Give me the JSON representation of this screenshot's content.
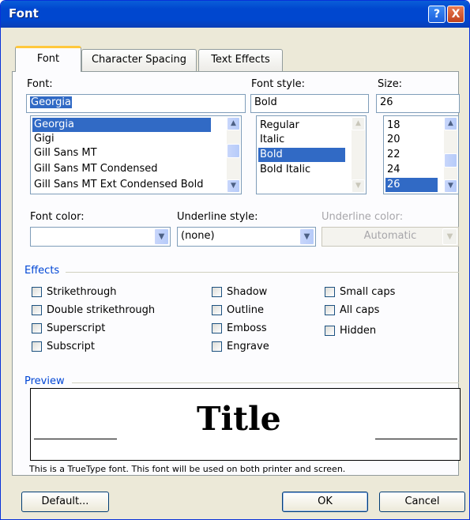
{
  "window": {
    "title": "Font",
    "help_label": "?",
    "close_label": "X"
  },
  "tabs": [
    {
      "label": "Font",
      "active": true
    },
    {
      "label": "Character Spacing",
      "active": false
    },
    {
      "label": "Text Effects",
      "active": false
    }
  ],
  "font": {
    "label": "Font:",
    "value": "Georgia",
    "items": [
      "Georgia",
      "Gigi",
      "Gill Sans MT",
      "Gill Sans MT Condensed",
      "Gill Sans MT Ext Condensed Bold"
    ],
    "selected": "Georgia"
  },
  "font_style": {
    "label": "Font style:",
    "value": "Bold",
    "items": [
      "Regular",
      "Italic",
      "Bold",
      "Bold Italic"
    ],
    "selected": "Bold"
  },
  "size": {
    "label": "Size:",
    "value": "26",
    "items": [
      "18",
      "20",
      "22",
      "24",
      "26"
    ],
    "selected": "26"
  },
  "font_color": {
    "label": "Font color:",
    "value": ""
  },
  "underline_style": {
    "label": "Underline style:",
    "value": "(none)"
  },
  "underline_color": {
    "label": "Underline color:",
    "value": "Automatic"
  },
  "effects": {
    "label": "Effects",
    "col1": [
      {
        "label": "Strikethrough",
        "checked": false
      },
      {
        "label": "Double strikethrough",
        "checked": false
      },
      {
        "label": "Superscript",
        "checked": false
      },
      {
        "label": "Subscript",
        "checked": false
      }
    ],
    "col2": [
      {
        "label": "Shadow",
        "checked": false
      },
      {
        "label": "Outline",
        "checked": false
      },
      {
        "label": "Emboss",
        "checked": false
      },
      {
        "label": "Engrave",
        "checked": false
      }
    ],
    "col3": [
      {
        "label": "Small caps",
        "checked": false
      },
      {
        "label": "All caps",
        "checked": false
      },
      {
        "label": "Hidden",
        "checked": false
      }
    ]
  },
  "preview": {
    "label": "Preview",
    "sample_text": "Title",
    "note": "This is a TrueType font. This font will be used on both printer and screen."
  },
  "buttons": {
    "default": "Default...",
    "ok": "OK",
    "cancel": "Cancel"
  },
  "colors": {
    "title_bar": "#0047cf",
    "selection": "#316ac5",
    "active_tab_accent": "#ffc83c"
  }
}
